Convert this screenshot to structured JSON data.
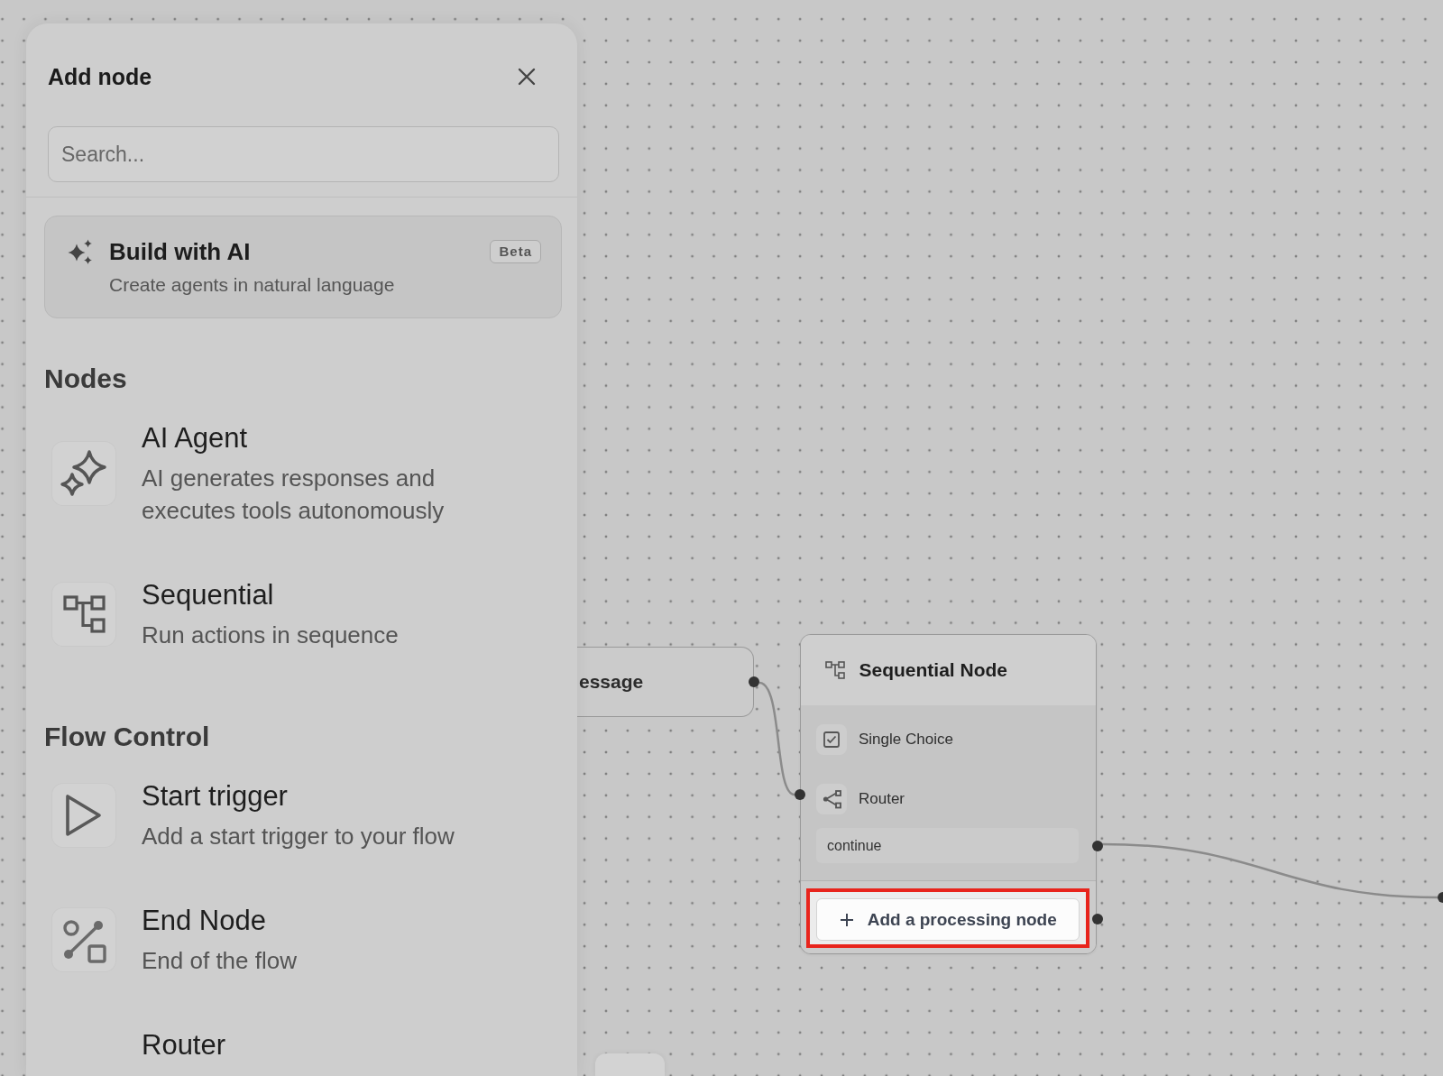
{
  "panel": {
    "title": "Add node",
    "search": {
      "placeholder": "Search..."
    },
    "featured": {
      "title": "Build with AI",
      "badge": "Beta",
      "description": "Create agents in natural language"
    },
    "sections": [
      {
        "heading": "Nodes",
        "items": [
          {
            "kind": "agent",
            "title": "AI Agent",
            "description": "AI generates responses and executes tools autonomously"
          },
          {
            "kind": "sequential",
            "title": "Sequential",
            "description": "Run actions in sequence"
          }
        ]
      },
      {
        "heading": "Flow Control",
        "items": [
          {
            "kind": "start",
            "title": "Start trigger",
            "description": "Add a start trigger to your flow"
          },
          {
            "kind": "end",
            "title": "End Node",
            "description": "End of the flow"
          },
          {
            "kind": "router",
            "title": "Router"
          }
        ]
      }
    ]
  },
  "canvas": {
    "nodes": [
      {
        "kind": "message",
        "label": "essage"
      },
      {
        "kind": "sequential",
        "title": "Sequential Node",
        "steps": [
          {
            "kind": "choice",
            "label": "Single Choice"
          },
          {
            "kind": "router",
            "label": "Router"
          }
        ],
        "outputs": [
          "continue"
        ],
        "add_button": {
          "label": "Add a processing node",
          "highlighted": true
        }
      }
    ]
  }
}
